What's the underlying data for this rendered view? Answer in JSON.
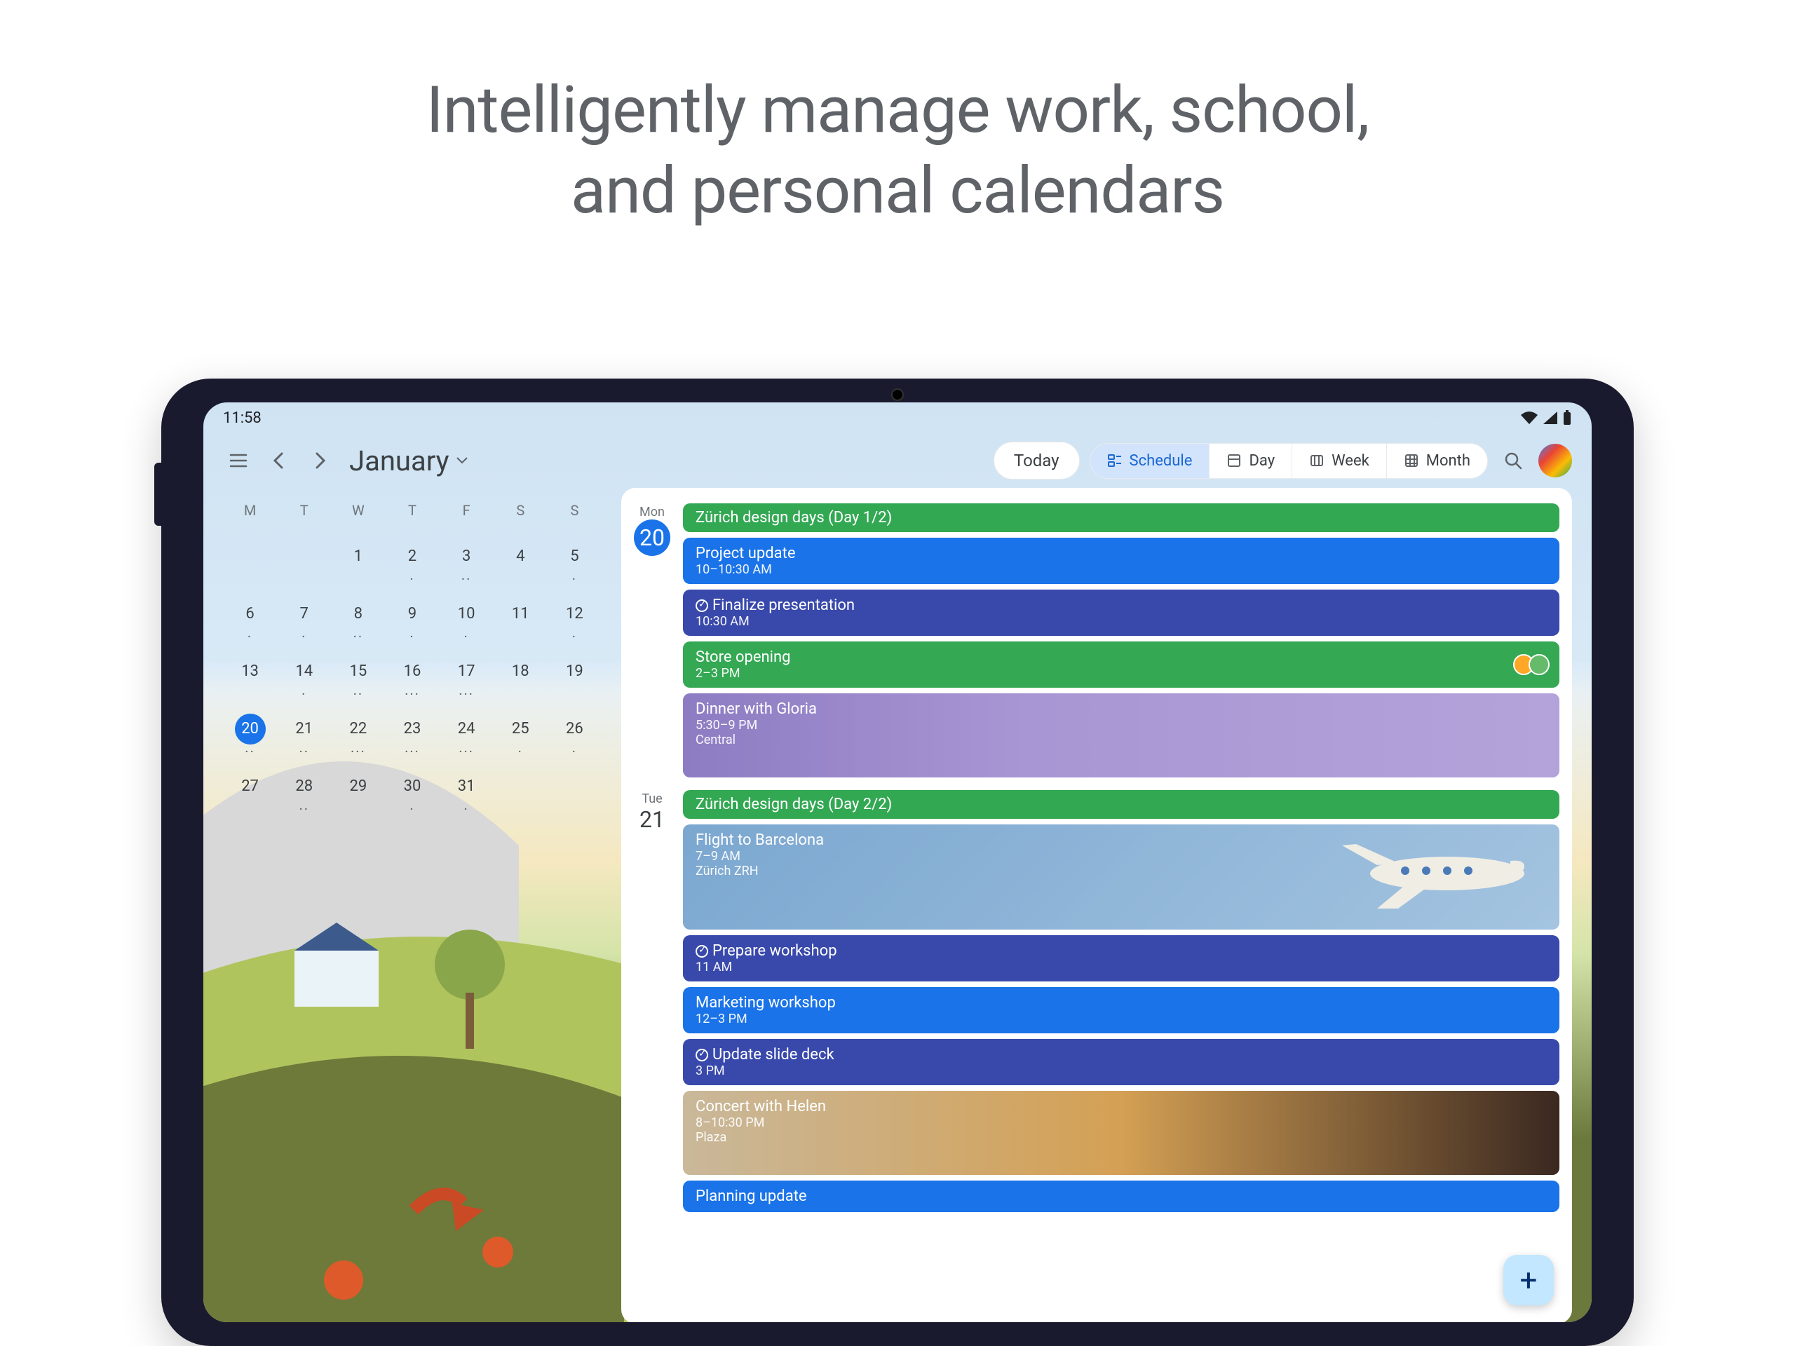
{
  "headline_line1": "Intelligently manage work, school,",
  "headline_line2": "and personal calendars",
  "status": {
    "time": "11:58"
  },
  "topbar": {
    "month": "January",
    "today": "Today",
    "views": {
      "schedule": "Schedule",
      "day": "Day",
      "week": "Week",
      "month": "Month"
    }
  },
  "minical": {
    "dow": [
      "M",
      "T",
      "W",
      "T",
      "F",
      "S",
      "S"
    ],
    "rows": [
      [
        {
          "n": "",
          "d": ""
        },
        {
          "n": "",
          "d": ""
        },
        {
          "n": "1",
          "d": ""
        },
        {
          "n": "2",
          "d": "."
        },
        {
          "n": "3",
          "d": ".."
        },
        {
          "n": "4",
          "d": ""
        },
        {
          "n": "5",
          "d": "."
        }
      ],
      [
        {
          "n": "6",
          "d": "."
        },
        {
          "n": "7",
          "d": "."
        },
        {
          "n": "8",
          "d": ".."
        },
        {
          "n": "9",
          "d": "."
        },
        {
          "n": "10",
          "d": "."
        },
        {
          "n": "11",
          "d": ""
        },
        {
          "n": "12",
          "d": "."
        }
      ],
      [
        {
          "n": "13",
          "d": ""
        },
        {
          "n": "14",
          "d": "."
        },
        {
          "n": "15",
          "d": ".."
        },
        {
          "n": "16",
          "d": "..."
        },
        {
          "n": "17",
          "d": "..."
        },
        {
          "n": "18",
          "d": ""
        },
        {
          "n": "19",
          "d": ""
        }
      ],
      [
        {
          "n": "20",
          "d": "..",
          "today": true
        },
        {
          "n": "21",
          "d": ".."
        },
        {
          "n": "22",
          "d": "..."
        },
        {
          "n": "23",
          "d": "..."
        },
        {
          "n": "24",
          "d": "..."
        },
        {
          "n": "25",
          "d": "."
        },
        {
          "n": "26",
          "d": "."
        }
      ],
      [
        {
          "n": "27",
          "d": ""
        },
        {
          "n": "28",
          "d": ".."
        },
        {
          "n": "29",
          "d": ""
        },
        {
          "n": "30",
          "d": "."
        },
        {
          "n": "31",
          "d": "."
        },
        {
          "n": "",
          "d": ""
        },
        {
          "n": "",
          "d": ""
        }
      ]
    ]
  },
  "schedule": [
    {
      "dow": "Mon",
      "num": "20",
      "today": true,
      "events": [
        {
          "style": "green single-line",
          "title": "Zürich design days (Day 1/2)"
        },
        {
          "style": "blue",
          "title": "Project update",
          "meta": "10–10:30 AM"
        },
        {
          "style": "purple",
          "check": true,
          "title": "Finalize presentation",
          "meta": "10:30 AM",
          "now": true
        },
        {
          "style": "green-light",
          "title": "Store opening",
          "meta": "2–3 PM",
          "avatars": true
        },
        {
          "style": "img-dinner",
          "title": "Dinner with Gloria",
          "meta": "5:30–9 PM",
          "loc": "Central"
        }
      ]
    },
    {
      "dow": "Tue",
      "num": "21",
      "events": [
        {
          "style": "green single-line",
          "title": "Zürich design days (Day 2/2)"
        },
        {
          "style": "img-flight",
          "title": "Flight to Barcelona",
          "meta": "7–9 AM",
          "loc": "Zürich ZRH"
        },
        {
          "style": "purple",
          "check": true,
          "title": "Prepare workshop",
          "meta": "11 AM"
        },
        {
          "style": "blue",
          "title": "Marketing workshop",
          "meta": "12–3 PM"
        },
        {
          "style": "purple",
          "check": true,
          "title": "Update slide deck",
          "meta": "3 PM"
        },
        {
          "style": "img-concert",
          "title": "Concert with Helen",
          "meta": "8–10:30 PM",
          "loc": "Plaza"
        },
        {
          "style": "blue",
          "title": "Planning update"
        }
      ]
    }
  ]
}
